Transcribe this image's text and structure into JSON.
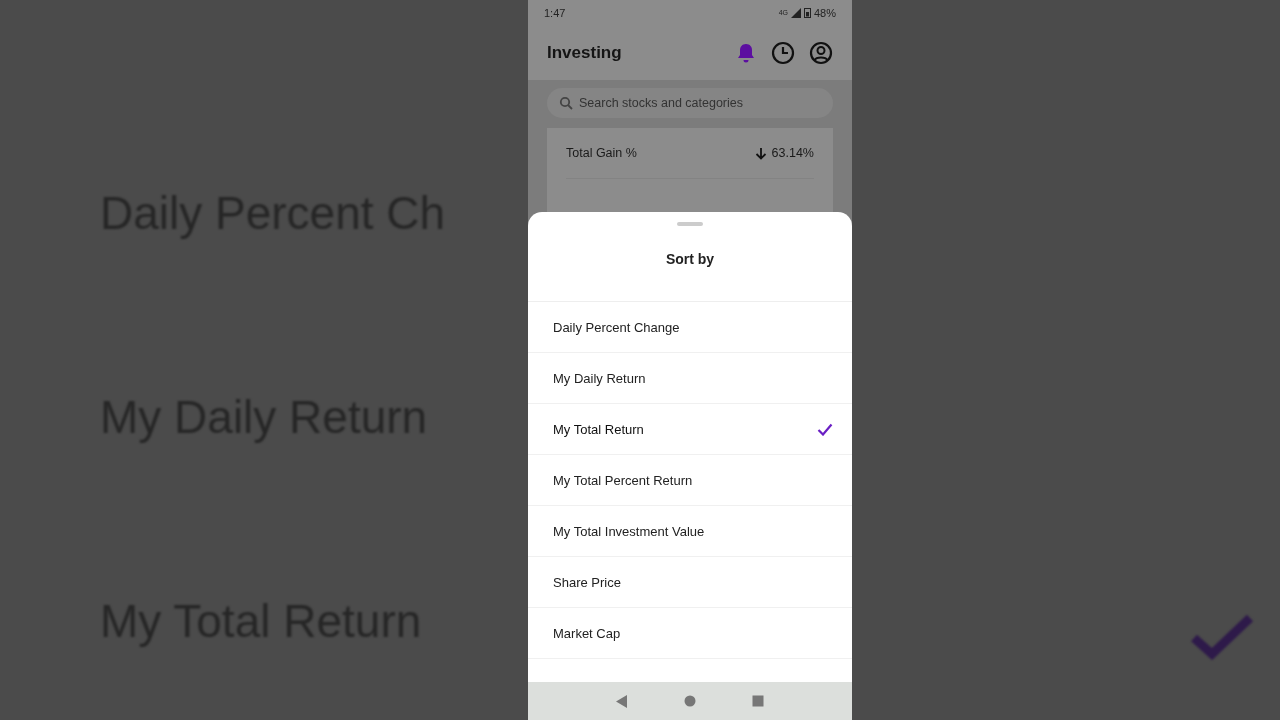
{
  "backdrop": {
    "labels": [
      "Daily Percent Ch",
      "My Daily Return",
      "My Total Return"
    ]
  },
  "status_bar": {
    "time": "1:47",
    "network": "4G",
    "battery": "48%"
  },
  "header": {
    "title": "Investing"
  },
  "search": {
    "placeholder": "Search stocks and categories"
  },
  "summary": {
    "label": "Total Gain %",
    "value": "63.14%"
  },
  "sheet": {
    "title": "Sort by",
    "options": [
      {
        "label": "Daily Percent Change",
        "selected": false
      },
      {
        "label": "My Daily Return",
        "selected": false
      },
      {
        "label": "My Total Return",
        "selected": true
      },
      {
        "label": "My Total Percent Return",
        "selected": false
      },
      {
        "label": "My Total Investment Value",
        "selected": false
      },
      {
        "label": "Share Price",
        "selected": false
      },
      {
        "label": "Market Cap",
        "selected": false
      }
    ]
  }
}
